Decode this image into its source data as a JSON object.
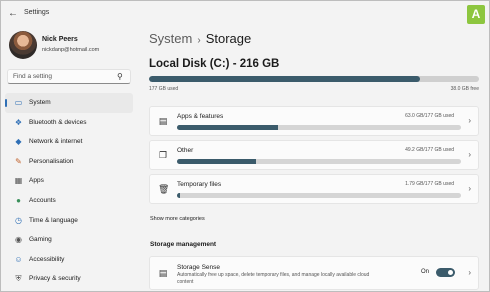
{
  "window": {
    "title": "Settings",
    "back_icon": "back-arrow-icon",
    "brand_badge": "A"
  },
  "profile": {
    "name": "Nick Peers",
    "email": "nickdanp@hotmail.com"
  },
  "search": {
    "placeholder": "Find a setting"
  },
  "nav": {
    "items": [
      {
        "label": "System",
        "icon": "system-icon",
        "active": true
      },
      {
        "label": "Bluetooth & devices",
        "icon": "bluetooth-icon"
      },
      {
        "label": "Network & internet",
        "icon": "network-icon"
      },
      {
        "label": "Personalisation",
        "icon": "brush-icon"
      },
      {
        "label": "Apps",
        "icon": "apps-icon"
      },
      {
        "label": "Accounts",
        "icon": "accounts-icon"
      },
      {
        "label": "Time & language",
        "icon": "time-language-icon"
      },
      {
        "label": "Gaming",
        "icon": "gaming-icon"
      },
      {
        "label": "Accessibility",
        "icon": "accessibility-icon"
      },
      {
        "label": "Privacy & security",
        "icon": "shield-icon"
      }
    ]
  },
  "breadcrumb": {
    "parent": "System",
    "separator": "›",
    "current": "Storage"
  },
  "disk": {
    "title": "Local Disk (C:) - 216 GB",
    "used_label": "177 GB used",
    "free_label": "38.0 GB free",
    "used_fraction": 0.82
  },
  "categories": [
    {
      "label": "Apps & features",
      "usage": "63.0 GB/177 GB used",
      "fraction": 0.356,
      "icon": "apps-features-icon"
    },
    {
      "label": "Other",
      "usage": "49.2 GB/177 GB used",
      "fraction": 0.278,
      "icon": "other-files-icon"
    },
    {
      "label": "Temporary files",
      "usage": "1.79 GB/177 GB used",
      "fraction": 0.01,
      "icon": "trash-icon"
    }
  ],
  "show_more": "Show more categories",
  "storage_management": {
    "heading": "Storage management",
    "storage_sense": {
      "title": "Storage Sense",
      "description": "Automatically free up space, delete temporary files, and manage locally available cloud content",
      "state": "On",
      "enabled": true
    }
  },
  "colors": {
    "accent": "#3b5b6b",
    "badge": "#8dc63f"
  }
}
